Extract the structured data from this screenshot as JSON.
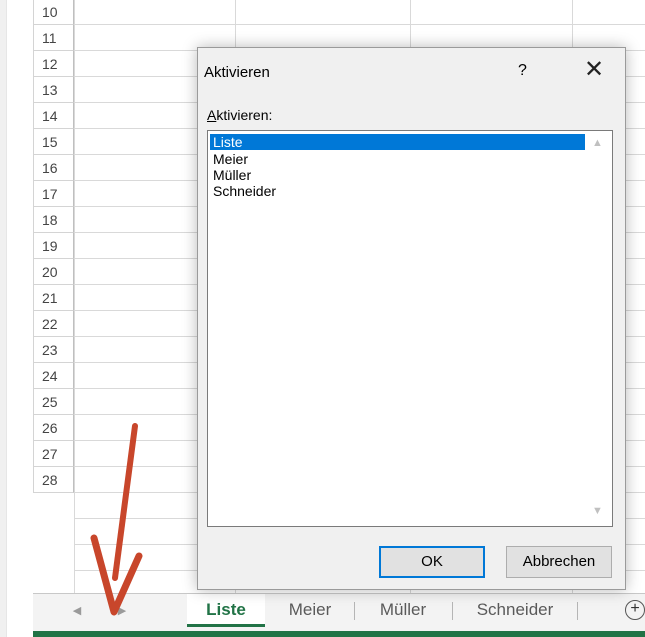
{
  "spreadsheet": {
    "rows": [
      "10",
      "11",
      "12",
      "13",
      "14",
      "15",
      "16",
      "17",
      "18",
      "19",
      "20",
      "21",
      "22",
      "23",
      "24",
      "25",
      "26",
      "27",
      "28"
    ]
  },
  "tabs": {
    "items": [
      {
        "label": "Liste",
        "active": true
      },
      {
        "label": "Meier",
        "active": false
      },
      {
        "label": "Müller",
        "active": false
      },
      {
        "label": "Schneider",
        "active": false
      }
    ],
    "add_icon": "plus-circle-icon",
    "accent_color": "#217346"
  },
  "dialog": {
    "title": "Aktivieren",
    "help": "?",
    "close": "✕",
    "label": "Aktivieren:",
    "list": [
      "Liste",
      "Meier",
      "Müller",
      "Schneider"
    ],
    "selected_index": 0,
    "selection_color": "#0078d7",
    "ok_label": "OK",
    "cancel_label": "Abbrechen"
  },
  "annotation": {
    "color": "#c8462b",
    "icon": "red-arrow-down-icon"
  }
}
